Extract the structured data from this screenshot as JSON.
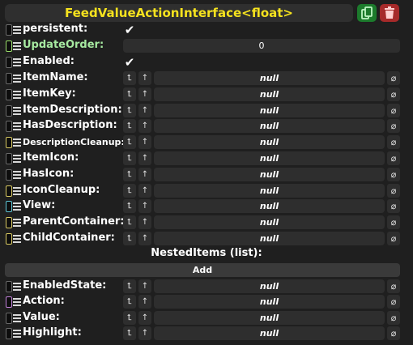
{
  "header": {
    "title": "FeedValueActionInterface<float>",
    "duplicate_icon": "duplicate-icon",
    "delete_icon": "trash-icon",
    "duplicate_color": "#1c7a2c",
    "delete_color": "#a62a2a",
    "title_color": "#f5e21e"
  },
  "persistent": {
    "label": "persistent:",
    "checked": true,
    "mark": "✔"
  },
  "update_order": {
    "label": "UpdateOrder:",
    "value": "0"
  },
  "enabled": {
    "label": "Enabled:",
    "checked": true,
    "mark": "✔"
  },
  "ref_fields": [
    {
      "label": "ItemName:",
      "value": "null"
    },
    {
      "label": "ItemKey:",
      "value": "null"
    },
    {
      "label": "ItemDescription:",
      "value": "null"
    },
    {
      "label": "HasDescription:",
      "value": "null"
    },
    {
      "label": "DescriptionCleanup:",
      "value": "null"
    },
    {
      "label": "ItemIcon:",
      "value": "null"
    },
    {
      "label": "HasIcon:",
      "value": "null"
    },
    {
      "label": "IconCleanup:",
      "value": "null"
    },
    {
      "label": "View:",
      "value": "null"
    },
    {
      "label": "ParentContainer:",
      "value": "null"
    },
    {
      "label": "ChildContainer:",
      "value": "null"
    }
  ],
  "nested_items": {
    "title": "NestedItems (list):",
    "add_label": "Add"
  },
  "item_fields": [
    {
      "label": "EnabledState:",
      "value": "null"
    },
    {
      "label": "Action:",
      "value": "null"
    },
    {
      "label": "Value:",
      "value": "null"
    },
    {
      "label": "Highlight:",
      "value": "null"
    }
  ],
  "glyphs": {
    "reset": "⮤",
    "up": "↑",
    "clear": "⌀"
  }
}
